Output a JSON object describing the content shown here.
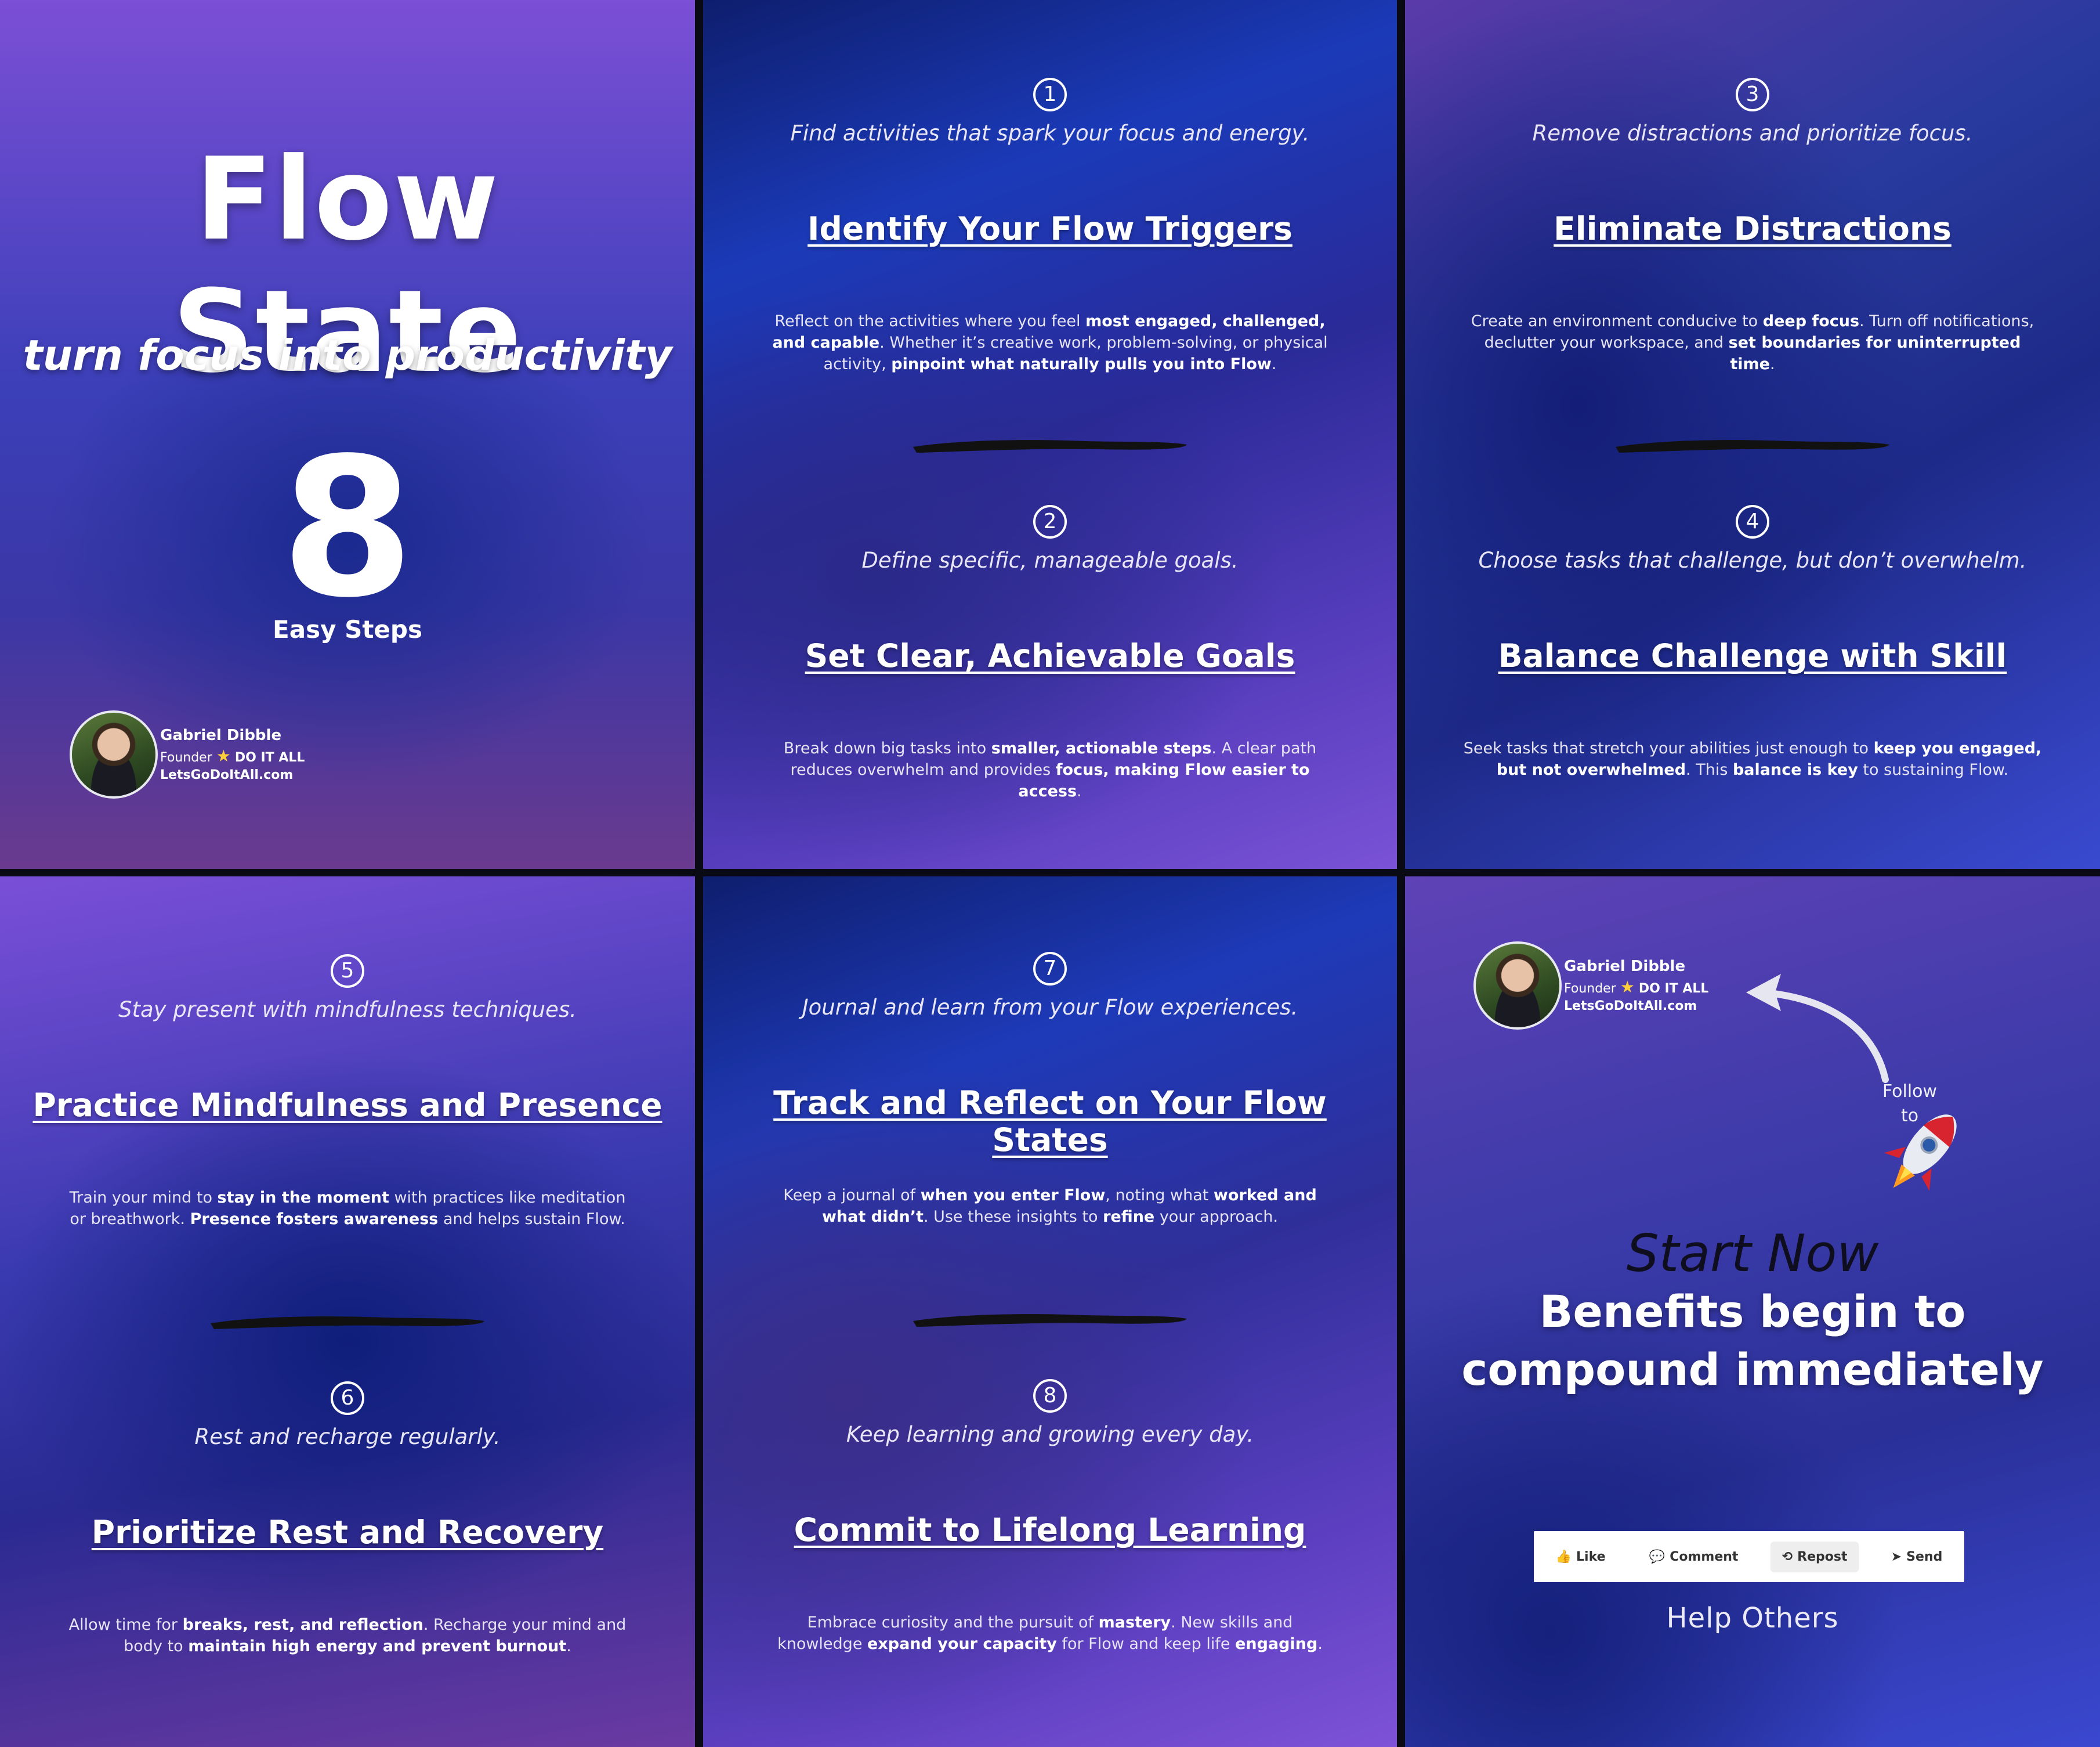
{
  "cover": {
    "title": "Flow State",
    "subtitle": "turn focus into productivity",
    "number": "8",
    "number_caption": "Easy Steps",
    "profile": {
      "name": "Gabriel Dibble",
      "role": "Founder",
      "brand": "DO IT ALL",
      "website": "LetsGoDoItAll.com"
    }
  },
  "steps": [
    {
      "num": "1",
      "tagline": "Find activities that spark your focus and energy.",
      "heading": "Identify Your Flow Triggers",
      "body": "Reflect on the activities where you feel most engaged, challenged, and capable. Whether it’s creative work, problem-solving, or physical activity, pinpoint what naturally pulls you into Flow."
    },
    {
      "num": "2",
      "tagline": "Define specific, manageable goals.",
      "heading": "Set Clear, Achievable Goals",
      "body": "Break down big tasks into smaller, actionable steps. A clear path reduces overwhelm and provides focus, making Flow easier to access."
    },
    {
      "num": "3",
      "tagline": "Remove distractions and prioritize focus.",
      "heading": "Eliminate Distractions",
      "body": "Create an environment conducive to deep focus. Turn off notifications, declutter your workspace, and set boundaries for uninterrupted time."
    },
    {
      "num": "4",
      "tagline": "Choose tasks that challenge, but don’t overwhelm.",
      "heading": "Balance Challenge with Skill",
      "body": "Seek tasks that stretch your abilities just enough to keep you engaged, but not overwhelmed. This balance is key to sustaining Flow."
    },
    {
      "num": "5",
      "tagline": "Stay present with mindfulness techniques.",
      "heading": "Practice Mindfulness and Presence",
      "body": "Train your mind to stay in the moment with practices like meditation or breathwork. Presence fosters awareness and helps sustain Flow."
    },
    {
      "num": "6",
      "tagline": "Rest and recharge regularly.",
      "heading": "Prioritize Rest and Recovery",
      "body": "Allow time for breaks, rest, and reflection. Recharge your mind and body to maintain high energy and prevent burnout."
    },
    {
      "num": "7",
      "tagline": "Journal and learn from your Flow experiences.",
      "heading": "Track and Reflect on Your Flow States",
      "body": "Keep a journal of when you enter Flow, noting what worked and what didn’t. Use these insights to refine your approach."
    },
    {
      "num": "8",
      "tagline": "Keep learning and growing every day.",
      "heading": "Commit to Lifelong Learning",
      "body": "Embrace curiosity and the pursuit of mastery. New skills and knowledge expand your capacity for Flow and keep life engaging."
    }
  ],
  "cta": {
    "profile": {
      "name": "Gabriel Dibble",
      "role": "Founder",
      "brand": "DO IT ALL",
      "website": "LetsGoDoItAll.com"
    },
    "follow_line1": "Follow",
    "follow_line2": "to",
    "start_now": "Start Now",
    "benefits_line1": "Benefits begin to",
    "benefits_line2": "compound immediately",
    "actions": [
      {
        "label": "Like",
        "icon": "thumbs-up-icon"
      },
      {
        "label": "Comment",
        "icon": "comment-icon"
      },
      {
        "label": "Repost",
        "icon": "repost-icon"
      },
      {
        "label": "Send",
        "icon": "send-icon"
      }
    ],
    "help_text": "Help Others"
  },
  "colors": {
    "accent_purple": "#7b4fd6",
    "deep_blue": "#1a2a8f",
    "star": "#ffcf3a"
  }
}
